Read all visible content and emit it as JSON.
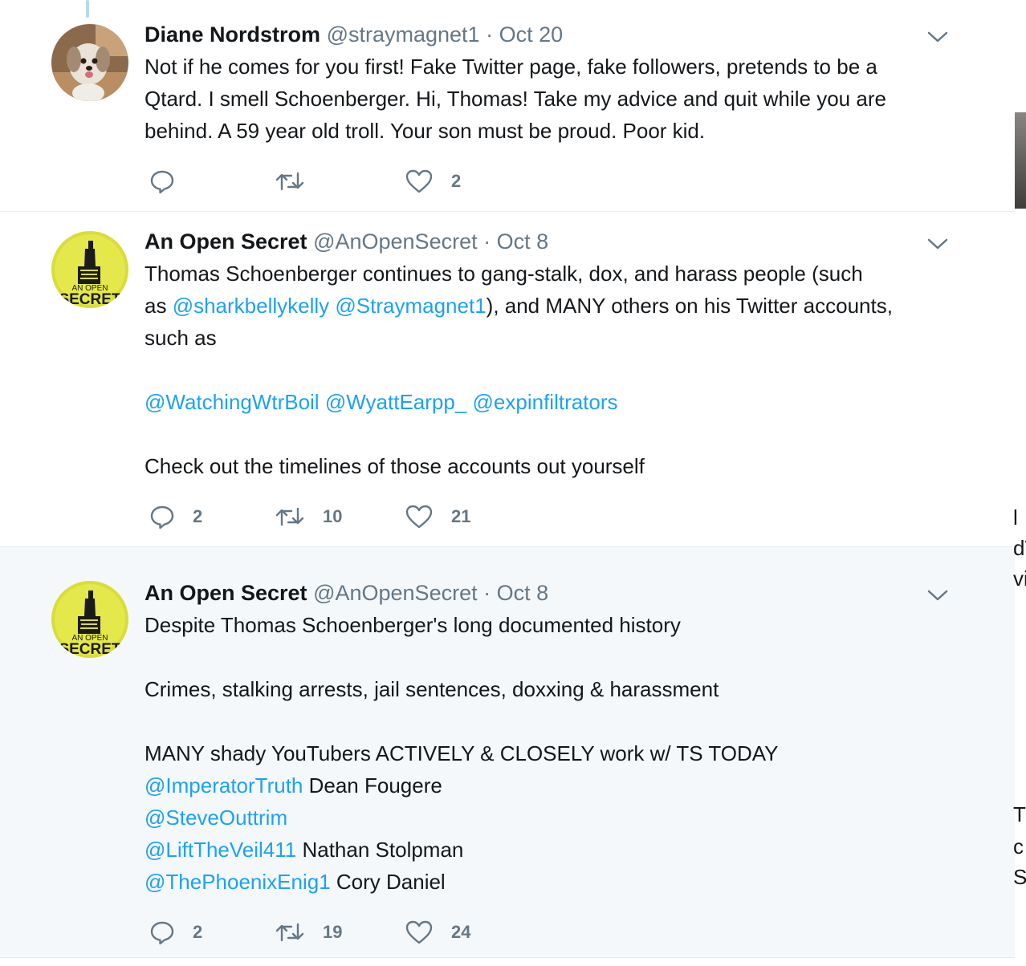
{
  "tweets": [
    {
      "name": "Diane Nordstrom",
      "handle": "@straymagnet1",
      "time": "Oct 20",
      "avatar": "dog-photo-avatar",
      "lines": [
        [
          {
            "t": "Not if he comes for you first! Fake Twitter page, fake followers, pretends to be a"
          }
        ],
        [
          {
            "t": "Qtard. I smell Schoenberger.  Hi, Thomas! Take my advice and quit while you are"
          }
        ],
        [
          {
            "t": "behind. A 59 year old troll. Your son must be proud. Poor kid."
          }
        ]
      ],
      "replies": "",
      "retweets": "",
      "likes": "2"
    },
    {
      "name": "An Open Secret",
      "handle": "@AnOpenSecret",
      "time": "Oct 8",
      "avatar": "an-open-secret-logo-avatar",
      "lines": [
        [
          {
            "t": "Thomas Schoenberger continues to gang-stalk, dox, and harass people (such"
          }
        ],
        [
          {
            "t": "as "
          },
          {
            "t": "@sharkbellykelly",
            "m": true
          },
          {
            "t": " "
          },
          {
            "t": "@Straymagnet1",
            "m": true
          },
          {
            "t": "), and MANY others on his Twitter accounts,"
          }
        ],
        [
          {
            "t": "such as"
          }
        ],
        [],
        [
          {
            "t": "@WatchingWtrBoil",
            "m": true
          },
          {
            "t": " "
          },
          {
            "t": "@WyattEarpp_",
            "m": true
          },
          {
            "t": " "
          },
          {
            "t": "@expinfiltrators",
            "m": true
          }
        ],
        [],
        [
          {
            "t": "Check out the timelines of those accounts out yourself"
          }
        ]
      ],
      "replies": "2",
      "retweets": "10",
      "likes": "21"
    },
    {
      "name": "An Open Secret",
      "handle": "@AnOpenSecret",
      "time": "Oct 8",
      "avatar": "an-open-secret-logo-avatar",
      "lines": [
        [
          {
            "t": "Despite Thomas Schoenberger's long documented history"
          }
        ],
        [],
        [
          {
            "t": "Crimes, stalking arrests, jail sentences, doxxing & harassment"
          }
        ],
        [],
        [
          {
            "t": "MANY shady YouTubers ACTIVELY & CLOSELY work w/ TS TODAY"
          }
        ],
        [
          {
            "t": "@ImperatorTruth",
            "m": true
          },
          {
            "t": " Dean Fougere"
          }
        ],
        [
          {
            "t": "@SteveOuttrim",
            "m": true
          }
        ],
        [
          {
            "t": "@LiftTheVeil411",
            "m": true
          },
          {
            "t": " Nathan Stolpman"
          }
        ],
        [
          {
            "t": "@ThePhoenixEnig1",
            "m": true
          },
          {
            "t": " Cory Daniel"
          }
        ]
      ],
      "replies": "2",
      "retweets": "19",
      "likes": "24"
    }
  ],
  "logo_text": {
    "line1": "AN OPEN",
    "line2": "SECRET"
  },
  "edge_fragments": [
    "l",
    "dT",
    "vil",
    "T",
    "c",
    "S"
  ],
  "colors": {
    "accent": "#1da1f2",
    "text": "#14171a",
    "muted": "#657786",
    "highlight_bg": "#f5f8fa",
    "divider": "#e6ecf0"
  }
}
